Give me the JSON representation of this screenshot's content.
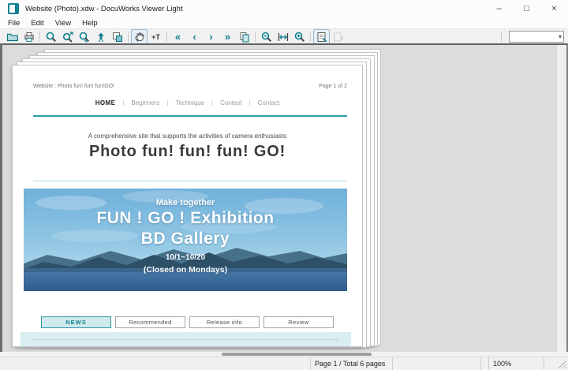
{
  "window": {
    "title": "Website (Photo).xdw - DocuWorks Viewer Light",
    "controls": {
      "minimize": "–",
      "maximize": "□",
      "close": "×"
    }
  },
  "menu": {
    "items": [
      "File",
      "Edit",
      "View",
      "Help"
    ]
  },
  "toolbar": {
    "glyphs": {
      "first": "«",
      "previous": "‹",
      "next": "›",
      "last": "»",
      "text_select": "+T",
      "dropdown": "▾"
    },
    "zoom_combo_value": ""
  },
  "document": {
    "header_left": "Website : Photo fun! fun! fun!GO!",
    "header_right": "Page 1 of 2",
    "nav": {
      "separator": "|",
      "items": [
        {
          "label": "HOME",
          "active": true
        },
        {
          "label": "Beginners",
          "active": false
        },
        {
          "label": "Technique",
          "active": false
        },
        {
          "label": "Contest",
          "active": false
        },
        {
          "label": "Contact",
          "active": false
        }
      ]
    },
    "tagline": "A comprehensive site that supports the activities of camera enthusiasts",
    "title": "Photo fun! fun! fun! GO!",
    "banner": {
      "line1": "Make together",
      "line2": "FUN ! GO ! Exhibition",
      "line3": "BD Gallery",
      "dates": "10/1~10/20",
      "closed": "(Closed on Mondays)"
    },
    "tabs": [
      {
        "label": "NEWS",
        "active": true
      },
      {
        "label": "Recommended",
        "active": false
      },
      {
        "label": "Release info",
        "active": false
      },
      {
        "label": "Review",
        "active": false
      }
    ]
  },
  "status_bar": {
    "page_info": "Page 1 / Total 6 pages",
    "zoom": "100%"
  },
  "colors": {
    "accent_teal": "#0d7d8d",
    "nav_rule": "#2b9fae",
    "banner_sky": "#74b2dc",
    "banner_mountain": "#2e5066",
    "banner_water": "#3c6e9d",
    "news_active_bg": "#cfe9ec",
    "news_active_border": "#2b97a5",
    "band_bg": "#daeef1"
  }
}
